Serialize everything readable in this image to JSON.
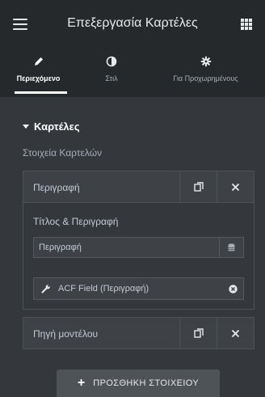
{
  "header": {
    "title": "Επεξεργασία Καρτέλες",
    "menu_icon": "hamburger-icon",
    "apps_icon": "grid-icon"
  },
  "tabs": [
    {
      "label": "Περιεχόμενο",
      "icon": "pencil-icon",
      "active": true
    },
    {
      "label": "Στιλ",
      "icon": "half-circle-icon",
      "active": false
    },
    {
      "label": "Για Προχωρημένους",
      "icon": "gear-icon",
      "active": false
    }
  ],
  "section": {
    "title": "Καρτέλες",
    "items_label": "Στοιχεία Καρτελών"
  },
  "repeater": {
    "item1": {
      "title": "Περιγραφή"
    },
    "body": {
      "label": "Τίτλος & Περιγραφή",
      "input_value": "Περιγραφή",
      "dynamic_tag": "ACF Field (Περιγραφή)"
    },
    "item2": {
      "title": "Πηγή μοντέλου"
    }
  },
  "add_button": {
    "label": "ΠΡΟΣΘΗΚΗ ΣΤΟΙΧΕΙΟΥ"
  },
  "colors": {
    "panel_bg": "#34383c",
    "header_bg": "#26292c",
    "item_bg": "#3e4247",
    "border": "#4d5257"
  }
}
